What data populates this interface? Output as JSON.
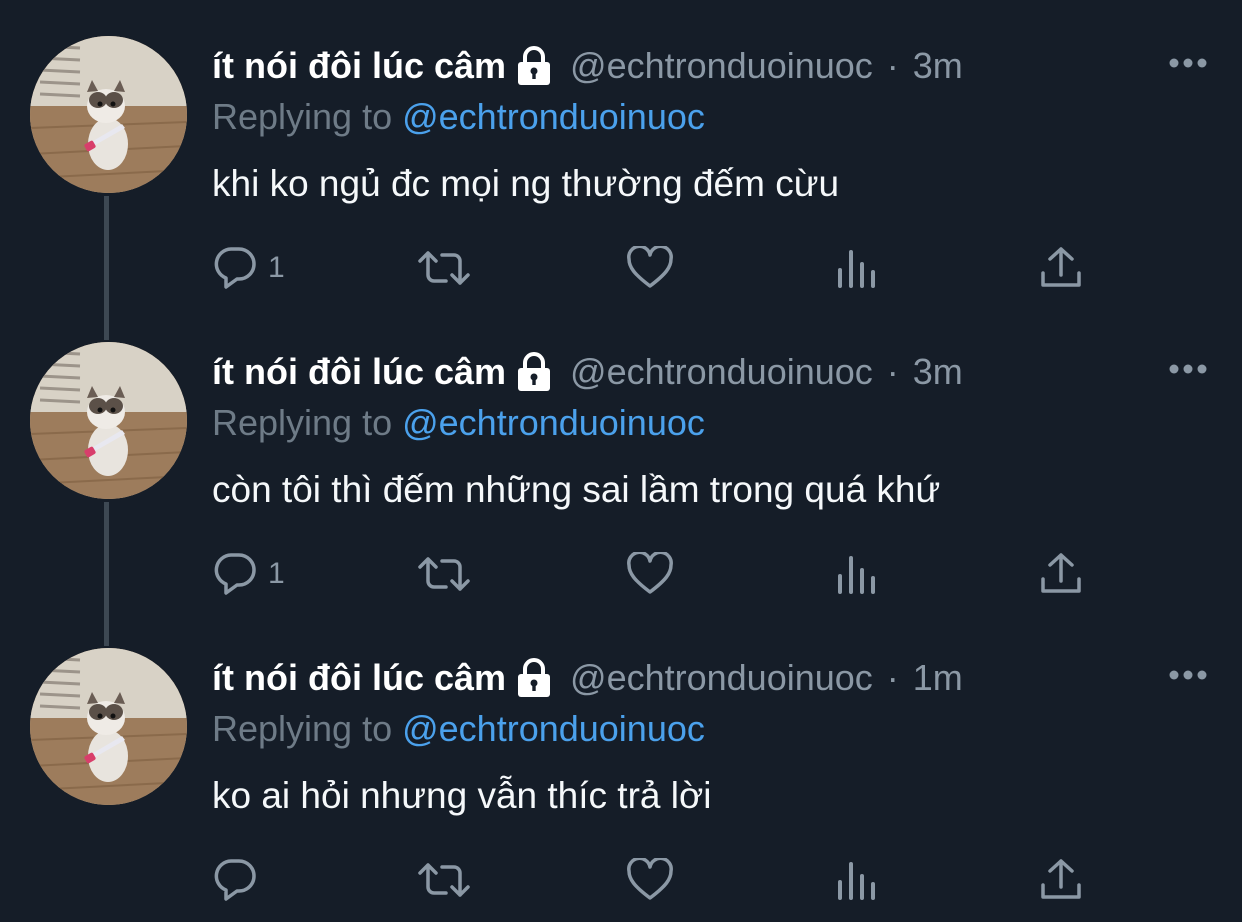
{
  "tweets": [
    {
      "display_name": "ít nói đôi lúc câm",
      "handle": "@echtronduoinuoc",
      "separator": "·",
      "time": "3m",
      "reply_prefix": "Replying to",
      "reply_handle": "@echtronduoinuoc",
      "text": "khi ko ngủ đc mọi ng thường đếm cừu",
      "reply_count": "1"
    },
    {
      "display_name": "ít nói đôi lúc câm",
      "handle": "@echtronduoinuoc",
      "separator": "·",
      "time": "3m",
      "reply_prefix": "Replying to",
      "reply_handle": "@echtronduoinuoc",
      "text": "còn tôi thì đếm những sai lầm trong quá khứ",
      "reply_count": "1"
    },
    {
      "display_name": "ít nói đôi lúc câm",
      "handle": "@echtronduoinuoc",
      "separator": "·",
      "time": "1m",
      "reply_prefix": "Replying to",
      "reply_handle": "@echtronduoinuoc",
      "text": "ko ai hỏi nhưng vẫn thíc trả lời",
      "reply_count": ""
    }
  ],
  "icons": {
    "lock": "lock-icon",
    "more": "more-icon",
    "reply": "reply-icon",
    "retweet": "retweet-icon",
    "like": "heart-icon",
    "views": "analytics-icon",
    "share": "share-icon"
  },
  "colors": {
    "background": "#151d28",
    "name": "#ffffff",
    "secondary": "#8b98a5",
    "link": "#4ba1ec",
    "thread_line": "#3d4853"
  }
}
